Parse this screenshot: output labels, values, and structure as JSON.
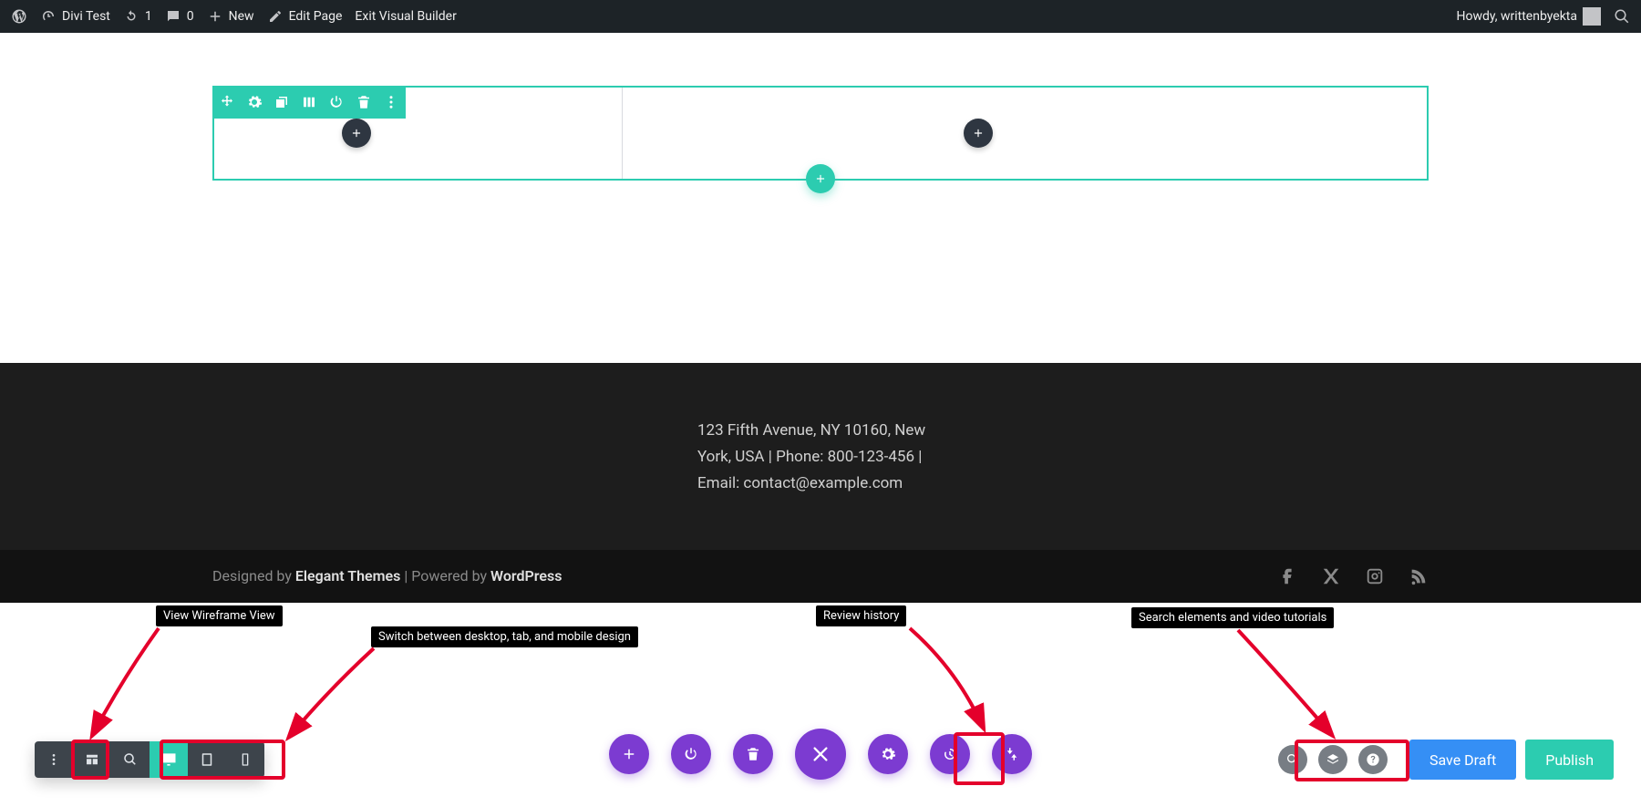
{
  "adminbar": {
    "site_title": "Divi Test",
    "updates_count": "1",
    "comments_count": "0",
    "new_label": "New",
    "edit_page": "Edit Page",
    "exit_vb": "Exit Visual Builder",
    "howdy": "Howdy, writtenbyekta"
  },
  "footer": {
    "text": "123 Fifth Avenue, NY 10160, New York, USA | Phone: 800-123-456 | Email: contact@example.com",
    "designed_by_prefix": "Designed by ",
    "designed_by_theme": "Elegant Themes",
    "powered_by_sep": " | Powered by ",
    "powered_by": "WordPress"
  },
  "tooltips": {
    "wireframe": "View Wireframe View",
    "responsive": "Switch between desktop, tab, and mobile design",
    "history": "Review history",
    "search": "Search elements and video tutorials"
  },
  "builder_bar": {
    "save_draft": "Save Draft",
    "publish": "Publish"
  }
}
